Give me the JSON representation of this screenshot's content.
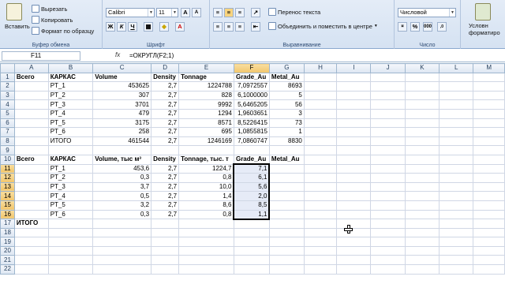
{
  "ribbon": {
    "clipboard": {
      "paste": "Вставить",
      "cut": "Вырезать",
      "copy": "Копировать",
      "format_painter": "Формат по образцу",
      "label": "Буфер обмена"
    },
    "font": {
      "name": "Calibri",
      "size": "11",
      "label": "Шрифт"
    },
    "alignment": {
      "wrap": "Перенос текста",
      "merge": "Объединить и поместить в центре",
      "label": "Выравнивание"
    },
    "number": {
      "format": "Числовой",
      "label": "Число"
    },
    "styles": {
      "conditional": "Условн форматиро"
    }
  },
  "formula_bar": {
    "cell": "F11",
    "fx": "fx",
    "formula": "=ОКРУГЛ(F2;1)"
  },
  "columns": [
    "A",
    "B",
    "C",
    "D",
    "E",
    "F",
    "G",
    "H",
    "I",
    "J",
    "K",
    "L",
    "M"
  ],
  "rows": [
    [
      "Всего",
      "КАРКАС",
      "Volume",
      "Density",
      "Tonnage",
      "Grade_Au",
      "Metal_Au"
    ],
    [
      "",
      "PT_1",
      "453625",
      "2,7",
      "1224788",
      "7,0972557",
      "8693"
    ],
    [
      "",
      "PT_2",
      "307",
      "2,7",
      "828",
      "6,1000000",
      "5"
    ],
    [
      "",
      "PT_3",
      "3701",
      "2,7",
      "9992",
      "5,6465205",
      "56"
    ],
    [
      "",
      "PT_4",
      "479",
      "2,7",
      "1294",
      "1,9603651",
      "3"
    ],
    [
      "",
      "PT_5",
      "3175",
      "2,7",
      "8571",
      "8,5226415",
      "73"
    ],
    [
      "",
      "PT_6",
      "258",
      "2,7",
      "695",
      "1,0855815",
      "1"
    ],
    [
      "",
      "ИТОГО",
      "461544",
      "2,7",
      "1246169",
      "7,0860747",
      "8830"
    ],
    [
      "",
      "",
      "",
      "",
      "",
      "",
      ""
    ],
    [
      "Всего",
      "КАРКАС",
      "Volume, тыс м³",
      "Density",
      "Tonnage, тыс. т",
      "Grade_Au",
      "Metal_Au"
    ],
    [
      "",
      "PT_1",
      "453,6",
      "2,7",
      "1224,7",
      "7,1",
      ""
    ],
    [
      "",
      "PT_2",
      "0,3",
      "2,7",
      "0,8",
      "6,1",
      ""
    ],
    [
      "",
      "PT_3",
      "3,7",
      "2,7",
      "10,0",
      "5,6",
      ""
    ],
    [
      "",
      "PT_4",
      "0,5",
      "2,7",
      "1,4",
      "2,0",
      ""
    ],
    [
      "",
      "PT_5",
      "3,2",
      "2,7",
      "8,6",
      "8,5",
      ""
    ],
    [
      "",
      "PT_6",
      "0,3",
      "2,7",
      "0,8",
      "1,1",
      ""
    ],
    [
      "ИТОГО",
      "",
      "",
      "",
      "",
      "",
      ""
    ],
    [
      "",
      "",
      "",
      "",
      "",
      "",
      ""
    ],
    [
      "",
      "",
      "",
      "",
      "",
      "",
      ""
    ],
    [
      "",
      "",
      "",
      "",
      "",
      "",
      ""
    ],
    [
      "",
      "",
      "",
      "",
      "",
      "",
      ""
    ],
    [
      "",
      "",
      "",
      "",
      "",
      "",
      ""
    ]
  ]
}
